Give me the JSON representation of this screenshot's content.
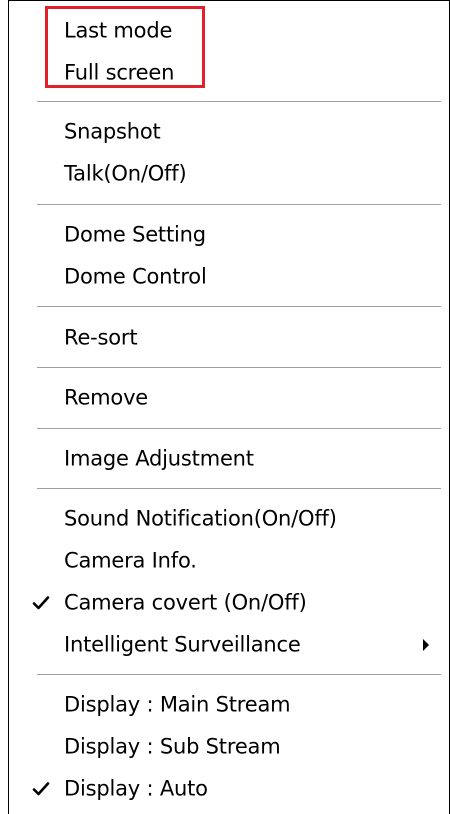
{
  "menu": {
    "items": [
      {
        "label": "Last mode",
        "checked": false,
        "submenu": false
      },
      {
        "label": "Full screen",
        "checked": false,
        "submenu": false
      },
      {
        "label": "Snapshot",
        "checked": false,
        "submenu": false
      },
      {
        "label": "Talk(On/Off)",
        "checked": false,
        "submenu": false
      },
      {
        "label": "Dome Setting",
        "checked": false,
        "submenu": false
      },
      {
        "label": "Dome Control",
        "checked": false,
        "submenu": false
      },
      {
        "label": "Re-sort",
        "checked": false,
        "submenu": false
      },
      {
        "label": "Remove",
        "checked": false,
        "submenu": false
      },
      {
        "label": "Image Adjustment",
        "checked": false,
        "submenu": false
      },
      {
        "label": "Sound Notification(On/Off)",
        "checked": false,
        "submenu": false
      },
      {
        "label": "Camera Info.",
        "checked": false,
        "submenu": false
      },
      {
        "label": "Camera covert (On/Off)",
        "checked": true,
        "submenu": false
      },
      {
        "label": "Intelligent Surveillance",
        "checked": false,
        "submenu": true
      },
      {
        "label": "Display : Main Stream",
        "checked": false,
        "submenu": false
      },
      {
        "label": "Display : Sub Stream",
        "checked": false,
        "submenu": false
      },
      {
        "label": "Display : Auto",
        "checked": true,
        "submenu": false
      }
    ]
  },
  "icons": {
    "check": "check-icon",
    "submenu_arrow": "submenu-arrow-icon"
  },
  "colors": {
    "highlight_border": "#e0202a",
    "separator": "#a0a0a0",
    "text": "#000000",
    "background": "#ffffff"
  }
}
